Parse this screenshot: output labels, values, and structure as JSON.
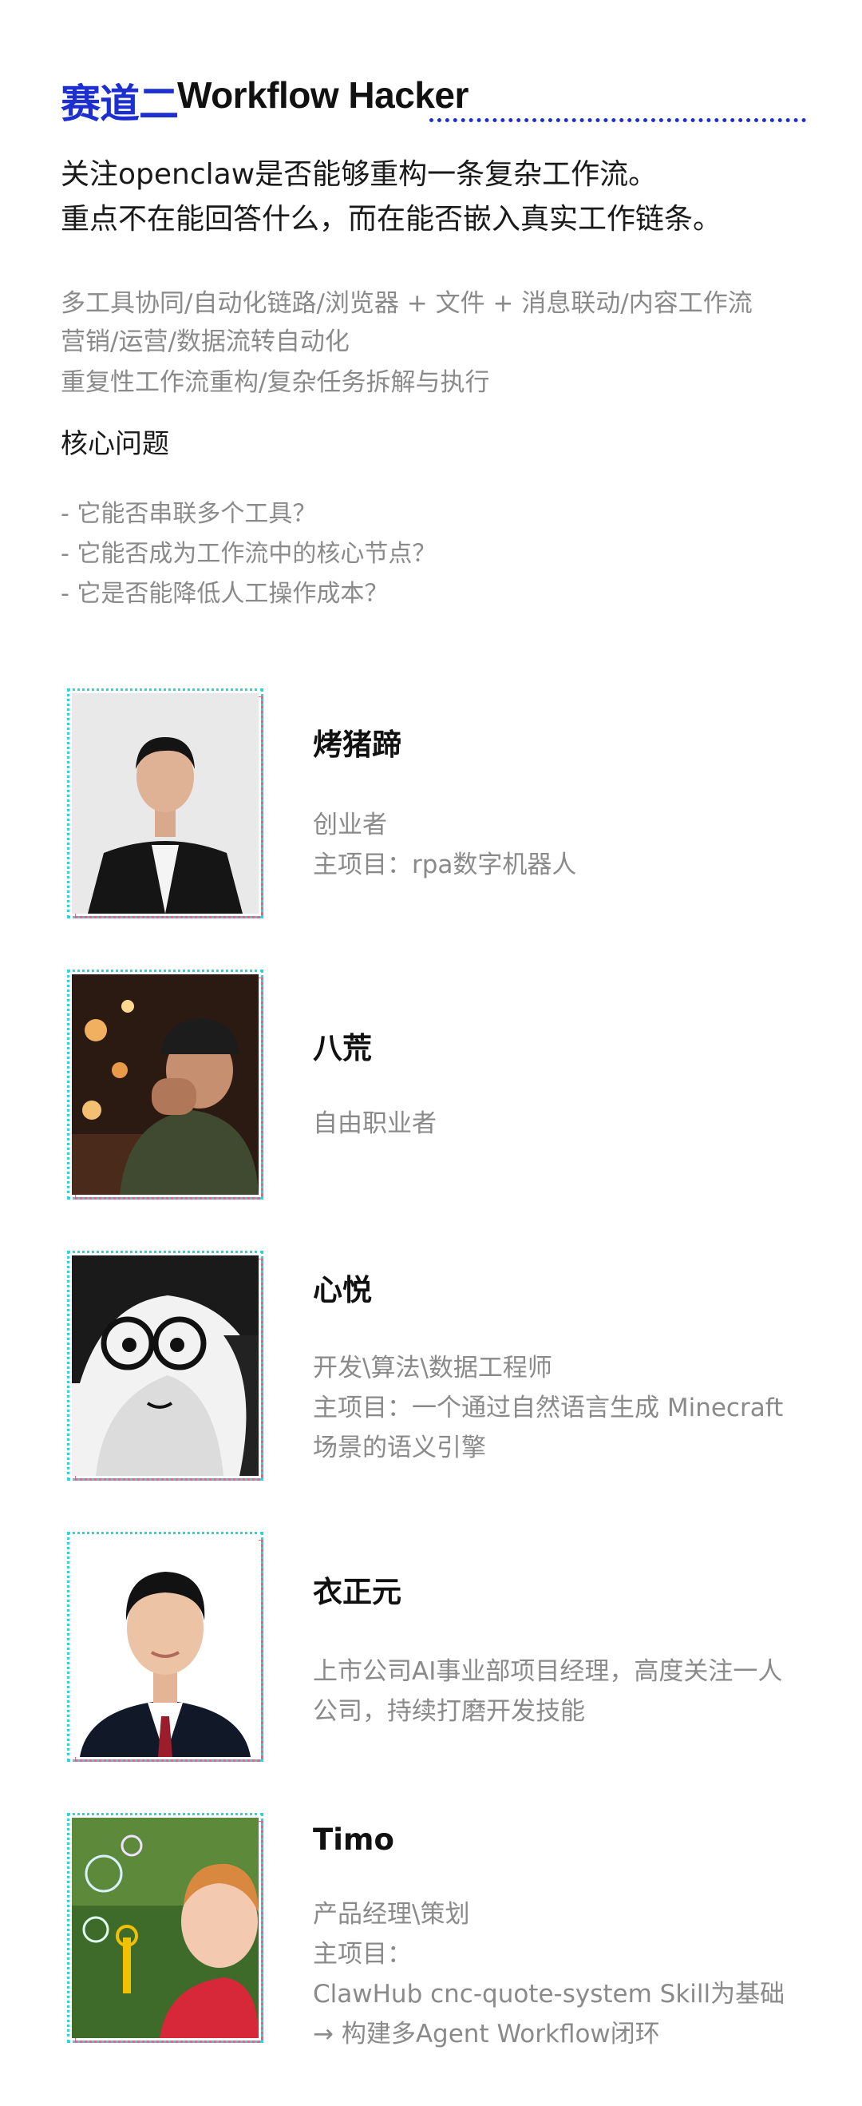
{
  "header": {
    "track_tag": "赛道二",
    "track_name": "Workflow Hacker",
    "accent_color": "#1d2fd1"
  },
  "intro": {
    "line1": "关注openclaw是否能够重构一条复杂工作流。",
    "line2": "重点不在能回答什么，而在能否嵌入真实工作链条。"
  },
  "tags": {
    "line1": "多工具协同/自动化链路/浏览器 + 文件 + 消息联动/内容工作流",
    "line2": "营销/运营/数据流转自动化",
    "line3": "重复性工作流重构/复杂任务拆解与执行"
  },
  "core": {
    "title": "核心问题",
    "questions": [
      "- 它能否串联多个工具？",
      "- 它能否成为工作流中的核心节点？",
      "- 它是否能降低人工操作成本？"
    ]
  },
  "people": [
    {
      "name": "烤猪蹄",
      "lines": [
        "创业者",
        "主项目：rpa数字机器人"
      ],
      "photo_icon": "person-portrait-suit-icon"
    },
    {
      "name": "八荒",
      "lines": [
        "自由职业者"
      ],
      "photo_icon": "person-portrait-cap-icon"
    },
    {
      "name": "心悦",
      "lines": [
        "开发\\算法\\数据工程师",
        "主项目：一个通过自然语言生成 Minecraft",
        "场景的语义引擎"
      ],
      "photo_icon": "manga-portrait-glasses-icon"
    },
    {
      "name": "衣正元",
      "lines": [
        "上市公司AI事业部项目经理，高度关注一人",
        "公司，持续打磨开发技能"
      ],
      "photo_icon": "person-portrait-id-icon"
    },
    {
      "name": "Timo",
      "lines": [
        "产品经理\\策划",
        "主项目：",
        "ClawHub cnc-quote-system Skill为基础",
        "→ 构建多Agent Workflow闭环"
      ],
      "photo_icon": "child-bubbles-portrait-icon"
    }
  ],
  "photo_frame_colors": {
    "dotted": "#2dd6d6",
    "shadow": "#e8618c"
  }
}
